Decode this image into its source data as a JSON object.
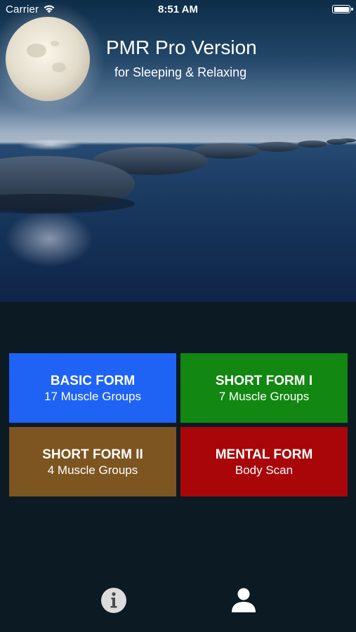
{
  "status_bar": {
    "carrier": "Carrier",
    "time": "8:51 AM",
    "wifi_icon": "wifi-icon",
    "battery_icon": "battery-icon"
  },
  "header": {
    "title": "PMR Pro Version",
    "subtitle": "for Sleeping & Relaxing",
    "background_image": "moon-over-stepping-stones-in-sea"
  },
  "menu": {
    "buttons": [
      {
        "title": "BASIC FORM",
        "subtitle": "17 Muscle Groups",
        "color": "#1f63f4"
      },
      {
        "title": "SHORT FORM I",
        "subtitle": "7 Muscle Groups",
        "color": "#128712"
      },
      {
        "title": "SHORT FORM II",
        "subtitle": "4 Muscle Groups",
        "color": "#7c5520"
      },
      {
        "title": "MENTAL FORM",
        "subtitle": "Body Scan",
        "color": "#a9060a"
      }
    ]
  },
  "bottom_bar": {
    "info_icon": "info-icon",
    "profile_icon": "person-icon"
  },
  "colors": {
    "background": "#0c1a24",
    "text": "#ffffff"
  }
}
